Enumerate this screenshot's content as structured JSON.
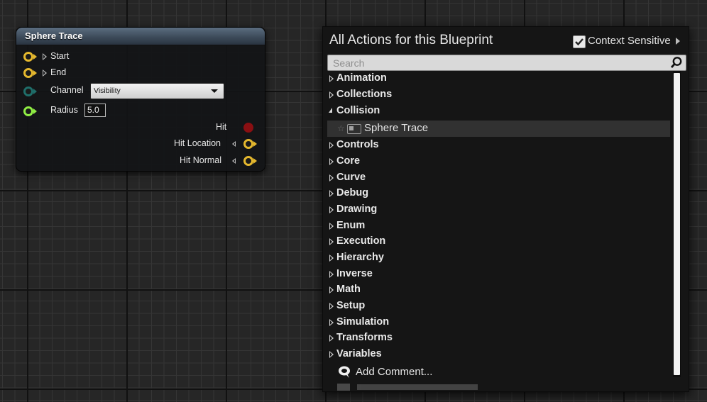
{
  "node": {
    "title": "Sphere Trace",
    "inputs": {
      "start": "Start",
      "end": "End",
      "channel_label": "Channel",
      "channel_value": "Visibility",
      "radius_label": "Radius",
      "radius_value": "5.0"
    },
    "outputs": {
      "hit": "Hit",
      "hit_location": "Hit Location",
      "hit_normal": "Hit Normal"
    },
    "colors": {
      "struct_pin": "#e5b82e",
      "channel_pin": "#1f6e6a",
      "float_pin": "#90ee44",
      "bool_pin": "#8a0f12"
    }
  },
  "menu": {
    "title": "All Actions for this Blueprint",
    "context_sensitive_label": "Context Sensitive",
    "context_sensitive_checked": true,
    "search_placeholder": "Search",
    "categories": [
      "Animation",
      "Collections",
      "Collision",
      "Controls",
      "Core",
      "Curve",
      "Debug",
      "Drawing",
      "Enum",
      "Execution",
      "Hierarchy",
      "Inverse",
      "Math",
      "Setup",
      "Simulation",
      "Transforms",
      "Variables"
    ],
    "expanded_category": "Collision",
    "collision_item": "Sphere Trace",
    "add_comment": "Add Comment..."
  }
}
